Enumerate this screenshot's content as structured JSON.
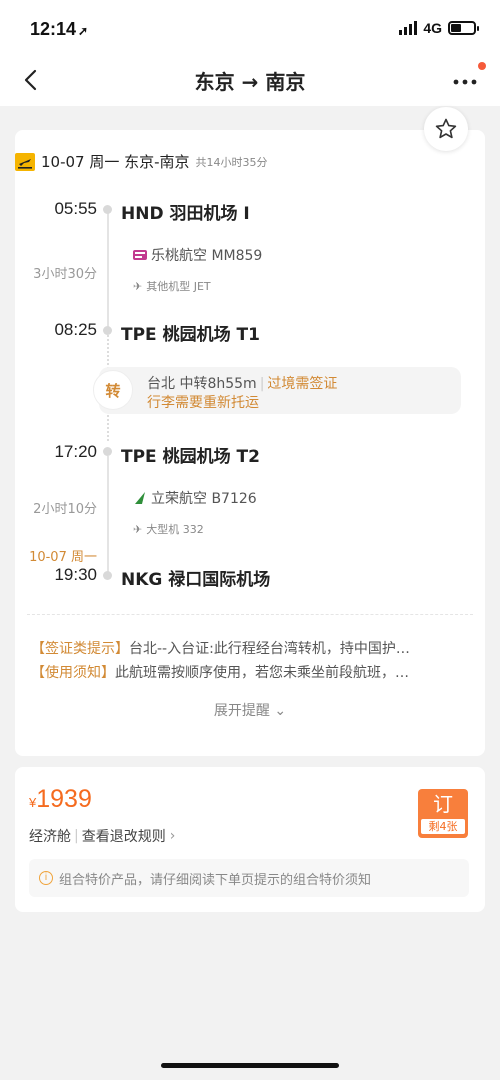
{
  "status_bar": {
    "time": "12:14",
    "network": "4G",
    "battery_level": 0.45
  },
  "nav": {
    "title": "东京 → 南京"
  },
  "flight": {
    "summary": {
      "date_route": "10-07 周一 东京-南京",
      "total": "共14小时35分"
    },
    "segments": [
      {
        "dep_time": "05:55",
        "dep_airport": "HND 羽田机场 I",
        "duration": "3小时30分",
        "airline": "乐桃航空 MM859",
        "aircraft": "其他机型 JET",
        "arr_time": "08:25",
        "arr_airport": "TPE 桃园机场 T1"
      },
      {
        "dep_time": "17:20",
        "dep_airport": "TPE 桃园机场 T2",
        "duration": "2小时10分",
        "airline": "立荣航空 B7126",
        "aircraft": "大型机 332",
        "arr_date": "10-07 周一",
        "arr_time": "19:30",
        "arr_airport": "NKG 禄口国际机场"
      }
    ],
    "transfer": {
      "badge": "转",
      "city_duration": "台北 中转8h55m",
      "visa": "过境需签证",
      "baggage": "行李需要重新托运"
    },
    "notices": [
      {
        "tag": "【签证类提示】",
        "text": "台北--入台证:此行程经台湾转机，持中国护…"
      },
      {
        "tag": "【使用须知】",
        "text": "此航班需按顺序使用，若您未乘坐前段航班，…"
      }
    ],
    "expand_label": "展开提醒"
  },
  "booking": {
    "currency": "¥",
    "price": "1939",
    "cabin": "经济舱",
    "rules_link": "查看退改规则",
    "book_label": "订",
    "remaining": "剩4张",
    "tip": "组合特价产品，请仔细阅读下单页提示的组合特价须知"
  },
  "colors": {
    "accent": "#d28a35",
    "price": "#f56b1f",
    "book_button": "#f87f3c"
  }
}
